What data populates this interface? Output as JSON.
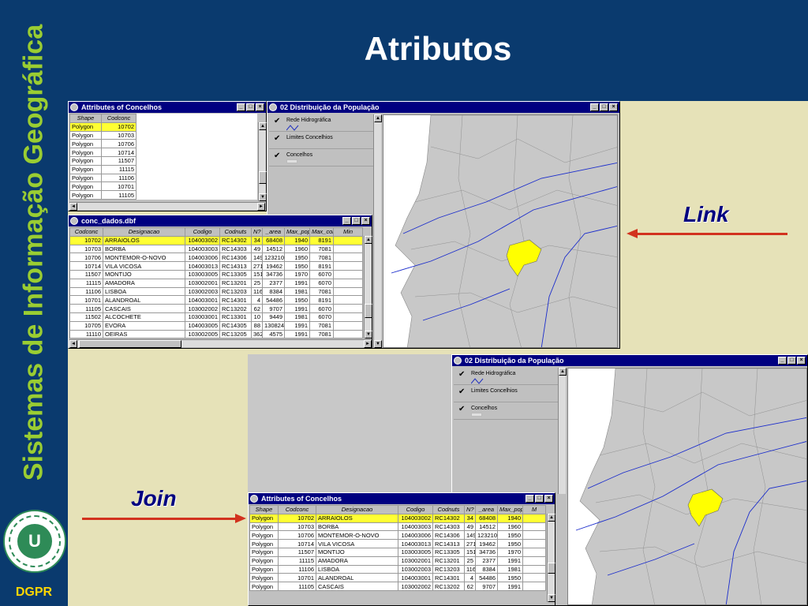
{
  "slide": {
    "title": "Atributos",
    "side_title": "Sistemas de Informação Geográfica",
    "footer_label": "DGPR",
    "logo_label": "U",
    "link_label": "Link",
    "join_label": "Join"
  },
  "colors": {
    "accent": "#9acd32",
    "highlight": "#ffff33",
    "arrow": "#d2321e",
    "title_bar": "#000080"
  },
  "win_attr_small": {
    "title": "Attributes of Concelhos",
    "columns": [
      "Shape",
      "Codconc"
    ],
    "rows": [
      [
        "Polygon",
        "10702"
      ],
      [
        "Polygon",
        "10703"
      ],
      [
        "Polygon",
        "10706"
      ],
      [
        "Polygon",
        "10714"
      ],
      [
        "Polygon",
        "11507"
      ],
      [
        "Polygon",
        "11115"
      ],
      [
        "Polygon",
        "11106"
      ],
      [
        "Polygon",
        "10701"
      ],
      [
        "Polygon",
        "11105"
      ]
    ]
  },
  "win_conc": {
    "title": "conc_dados.dbf",
    "columns": [
      "Codconc",
      "Designacao",
      "Codigo",
      "Codnuts",
      "N?",
      "_area",
      "Max_pop",
      "Max_con",
      "Min"
    ],
    "rows": [
      [
        "10702",
        "ARRAIOLOS",
        "104003002",
        "RC14302",
        "34",
        "68408",
        "1940",
        "8191"
      ],
      [
        "10703",
        "BORBA",
        "104003003",
        "RC14303",
        "49",
        "14512",
        "1960",
        "7081"
      ],
      [
        "10706",
        "MONTEMOR-O-NOVO",
        "104003006",
        "RC14306",
        "149",
        "123210",
        "1950",
        "7081"
      ],
      [
        "10714",
        "VILA VICOSA",
        "104003013",
        "RC14313",
        "271",
        "19462",
        "1950",
        "8191"
      ],
      [
        "11507",
        "MONTIJO",
        "103003005",
        "RC13305",
        "151",
        "34736",
        "1970",
        "6070"
      ],
      [
        "11115",
        "AMADORA",
        "103002001",
        "RC13201",
        "25",
        "2377",
        "1991",
        "6070"
      ],
      [
        "11106",
        "LISBOA",
        "103002003",
        "RC13203",
        "116",
        "8384",
        "1981",
        "7081"
      ],
      [
        "10701",
        "ALANDROAL",
        "104003001",
        "RC14301",
        "4",
        "54486",
        "1950",
        "8191"
      ],
      [
        "11105",
        "CASCAIS",
        "103002002",
        "RC13202",
        "62",
        "9707",
        "1991",
        "6070"
      ],
      [
        "11502",
        "ALCOCHETE",
        "103003001",
        "RC13301",
        "10",
        "9449",
        "1981",
        "6070"
      ],
      [
        "10705",
        "EVORA",
        "104003005",
        "RC14305",
        "88",
        "130824",
        "1991",
        "7081"
      ],
      [
        "11110",
        "OEIRAS",
        "103002005",
        "RC13205",
        "362",
        "4575",
        "1991",
        "7081"
      ]
    ]
  },
  "win_map_top": {
    "title": "02 Distribuição da População",
    "layers": [
      "Rede Hidrográfica",
      "Limites Concelhios",
      "Concelhos"
    ]
  },
  "win_map_bottom": {
    "title": "02 Distribuição da População",
    "layers": [
      "Rede Hidrográfica",
      "Limites Concelhios",
      "Concelhos"
    ]
  },
  "win_attr_join": {
    "title": "Attributes of Concelhos",
    "columns": [
      "Shape",
      "Codconc",
      "Designacao",
      "Codigo",
      "Codnuts",
      "N?",
      "_area",
      "Max_pop",
      "M"
    ],
    "rows": [
      [
        "Polygon",
        "10702",
        "ARRAIOLOS",
        "104003002",
        "RC14302",
        "34",
        "68408",
        "1940"
      ],
      [
        "Polygon",
        "10703",
        "BORBA",
        "104003003",
        "RC14303",
        "49",
        "14512",
        "1960"
      ],
      [
        "Polygon",
        "10706",
        "MONTEMOR-O-NOVO",
        "104003006",
        "RC14306",
        "149",
        "123210",
        "1950"
      ],
      [
        "Polygon",
        "10714",
        "VILA VICOSA",
        "104003013",
        "RC14313",
        "271",
        "19462",
        "1950"
      ],
      [
        "Polygon",
        "11507",
        "MONTIJO",
        "103003005",
        "RC13305",
        "151",
        "34736",
        "1970"
      ],
      [
        "Polygon",
        "11115",
        "AMADORA",
        "103002001",
        "RC13201",
        "25",
        "2377",
        "1991"
      ],
      [
        "Polygon",
        "11106",
        "LISBOA",
        "103002003",
        "RC13203",
        "116",
        "8384",
        "1981"
      ],
      [
        "Polygon",
        "10701",
        "ALANDROAL",
        "104003001",
        "RC14301",
        "4",
        "54486",
        "1950"
      ],
      [
        "Polygon",
        "11105",
        "CASCAIS",
        "103002002",
        "RC13202",
        "62",
        "9707",
        "1991"
      ]
    ]
  },
  "window_buttons": {
    "minimize": "_",
    "maximize": "□",
    "close": "×"
  },
  "scroll_arrows": {
    "up": "▲",
    "down": "▼",
    "left": "◄",
    "right": "►"
  },
  "check_mark": "✔"
}
